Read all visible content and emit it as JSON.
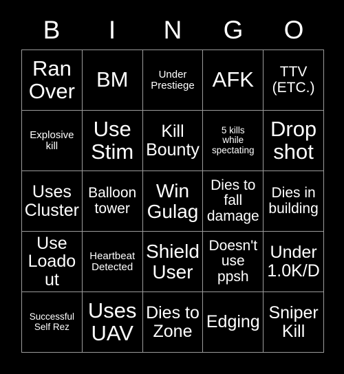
{
  "card": {
    "title": "BINGO",
    "background_color": "#000000",
    "text_color": "#ffffff",
    "grid_line_color": "#9d9d9d"
  },
  "header": {
    "letters": [
      "B",
      "I",
      "N",
      "G",
      "O"
    ]
  },
  "grid": {
    "rows": 5,
    "columns": 5,
    "cells": [
      {
        "text": "Ran\nOver",
        "size": "xxl"
      },
      {
        "text": "BM",
        "size": "xxl"
      },
      {
        "text": "Under\nPrestiege",
        "size": "s"
      },
      {
        "text": "AFK",
        "size": "xxl"
      },
      {
        "text": "TTV\n(ETC.)",
        "size": "m"
      },
      {
        "text": "Explosive\nkill",
        "size": "s"
      },
      {
        "text": "Use\nStim",
        "size": "xxl"
      },
      {
        "text": "Kill\nBounty",
        "size": "l"
      },
      {
        "text": "5 kills\nwhile\nspectating",
        "size": "xs"
      },
      {
        "text": "Drop\nshot",
        "size": "xxl"
      },
      {
        "text": "Uses\nCluster",
        "size": "l"
      },
      {
        "text": "Balloon\ntower",
        "size": "m"
      },
      {
        "text": "Win\nGulag",
        "size": "xl"
      },
      {
        "text": "Dies to\nfall\ndamage",
        "size": "m"
      },
      {
        "text": "Dies in\nbuilding",
        "size": "m"
      },
      {
        "text": "Use\nLoadout",
        "size": "l"
      },
      {
        "text": "Heartbeat\nDetected",
        "size": "s"
      },
      {
        "text": "Shield\nUser",
        "size": "xl"
      },
      {
        "text": "Doesn't\nuse\nppsh",
        "size": "m"
      },
      {
        "text": "Under\n1.0K/D",
        "size": "l"
      },
      {
        "text": "Successful\nSelf Rez",
        "size": "xs"
      },
      {
        "text": "Uses\nUAV",
        "size": "xxl"
      },
      {
        "text": "Dies to\nZone",
        "size": "l"
      },
      {
        "text": "Edging",
        "size": "l"
      },
      {
        "text": "Sniper\nKill",
        "size": "l"
      }
    ]
  }
}
